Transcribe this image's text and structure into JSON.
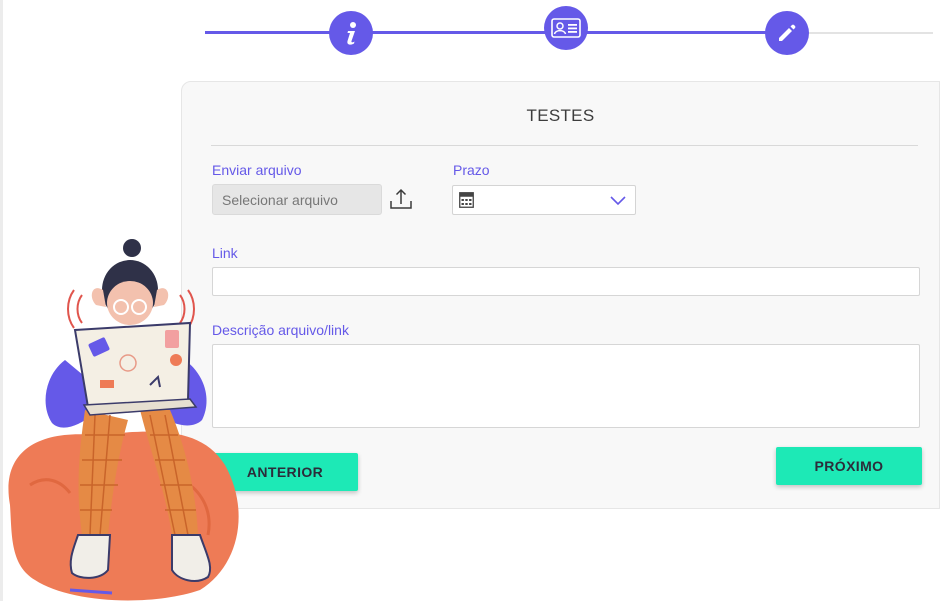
{
  "stepper": {
    "steps": [
      {
        "name": "info",
        "icon": "info-icon"
      },
      {
        "name": "profile",
        "icon": "id-card-icon"
      },
      {
        "name": "edit",
        "icon": "pencil-icon"
      }
    ],
    "accent_color": "#6559e8"
  },
  "form": {
    "title": "TESTES",
    "upload": {
      "label": "Enviar arquivo",
      "button_text": "Selecionar arquivo",
      "icon": "upload-icon"
    },
    "deadline": {
      "label": "Prazo",
      "value": "",
      "icons": [
        "calendar-icon",
        "chevron-down-icon"
      ]
    },
    "link": {
      "label": "Link",
      "value": ""
    },
    "description": {
      "label": "Descrição arquivo/link",
      "value": ""
    }
  },
  "buttons": {
    "previous": "ANTERIOR",
    "next": "PRÓXIMO",
    "color": "#1de9b6"
  },
  "illustration": {
    "icon": "person-with-laptop-illustration"
  }
}
